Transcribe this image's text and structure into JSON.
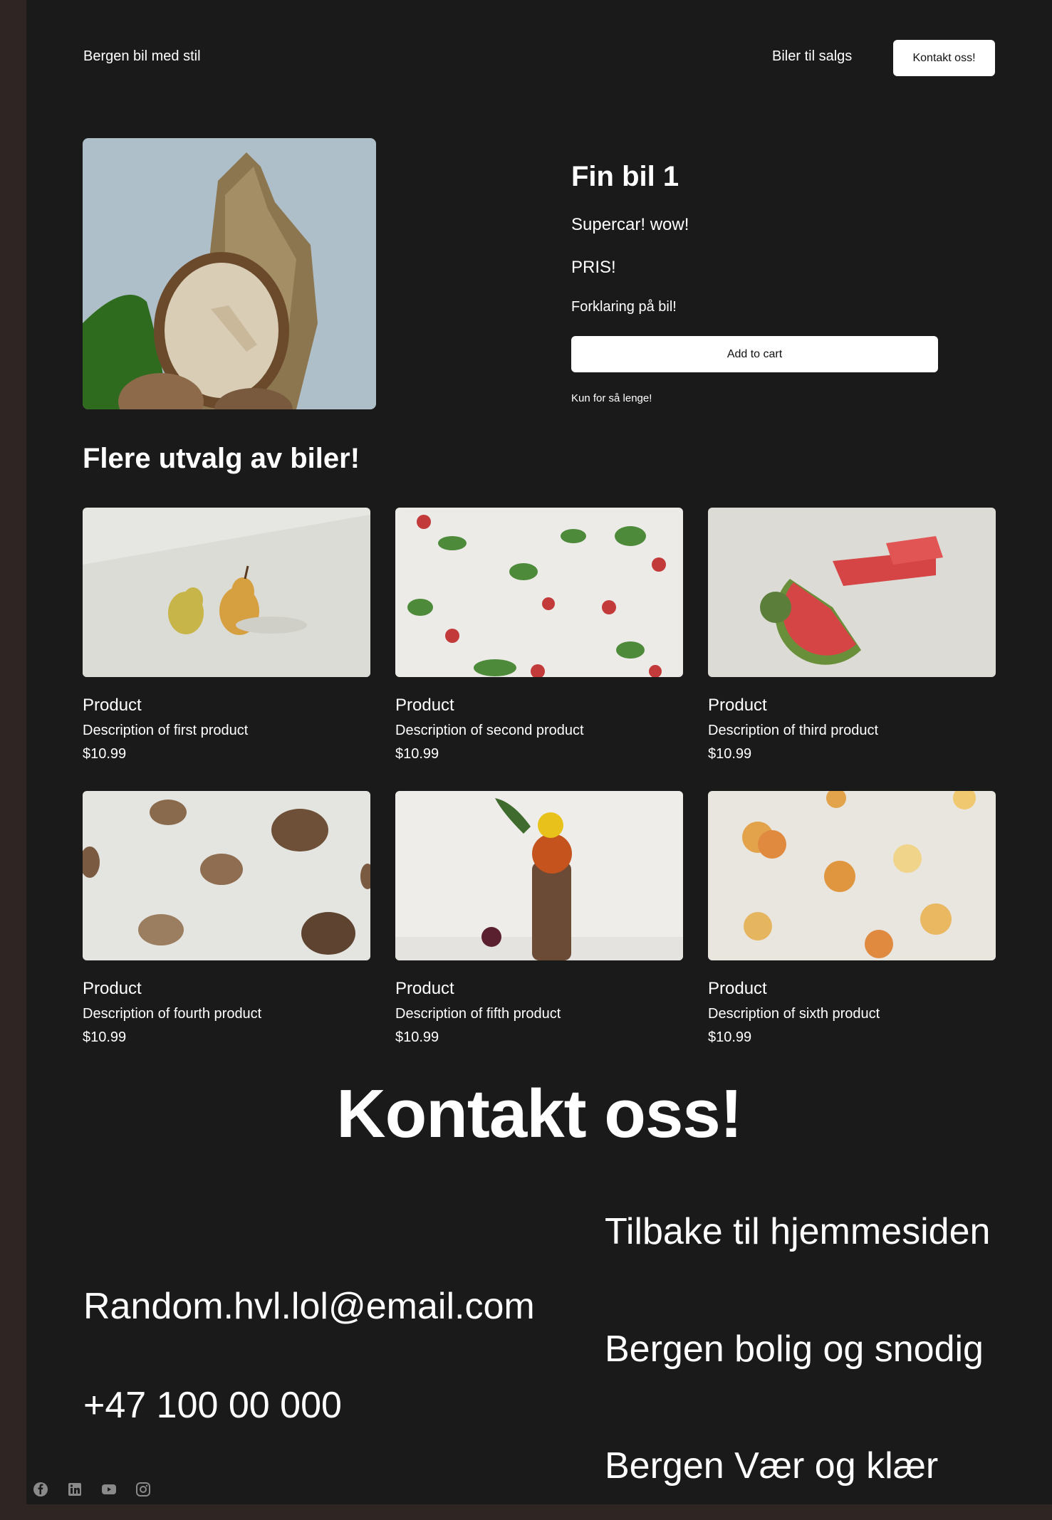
{
  "header": {
    "brand": "Bergen bil med stil",
    "nav_link": "Biler til salgs",
    "cta": "Kontakt oss!"
  },
  "hero": {
    "title": "Fin bil 1",
    "subtitle": "Supercar! wow!",
    "price": "PRIS!",
    "description": "Forklaring på bil!",
    "button": "Add to cart",
    "note": "Kun for så lenge!"
  },
  "products": {
    "title": "Flere utvalg av biler!",
    "items": [
      {
        "name": "Product",
        "description": "Description of first product",
        "price": "$10.99"
      },
      {
        "name": "Product",
        "description": "Description of second product",
        "price": "$10.99"
      },
      {
        "name": "Product",
        "description": "Description of third product",
        "price": "$10.99"
      },
      {
        "name": "Product",
        "description": "Description of fourth product",
        "price": "$10.99"
      },
      {
        "name": "Product",
        "description": "Description of fifth product",
        "price": "$10.99"
      },
      {
        "name": "Product",
        "description": "Description of sixth product",
        "price": "$10.99"
      }
    ]
  },
  "contact": {
    "title": "Kontakt oss!",
    "email": "Random.hvl.lol@email.com",
    "phone": "+47 100 00 000",
    "links": [
      "Tilbake til hjemmesiden",
      "Bergen bolig og snodig",
      "Bergen Vær og klær"
    ]
  },
  "socials": [
    "facebook-icon",
    "linkedin-icon",
    "youtube-icon",
    "instagram-icon"
  ],
  "colors": {
    "background": "#1a1a1a",
    "frame": "#2f2523",
    "button_bg": "#ffffff",
    "text": "#ffffff"
  }
}
